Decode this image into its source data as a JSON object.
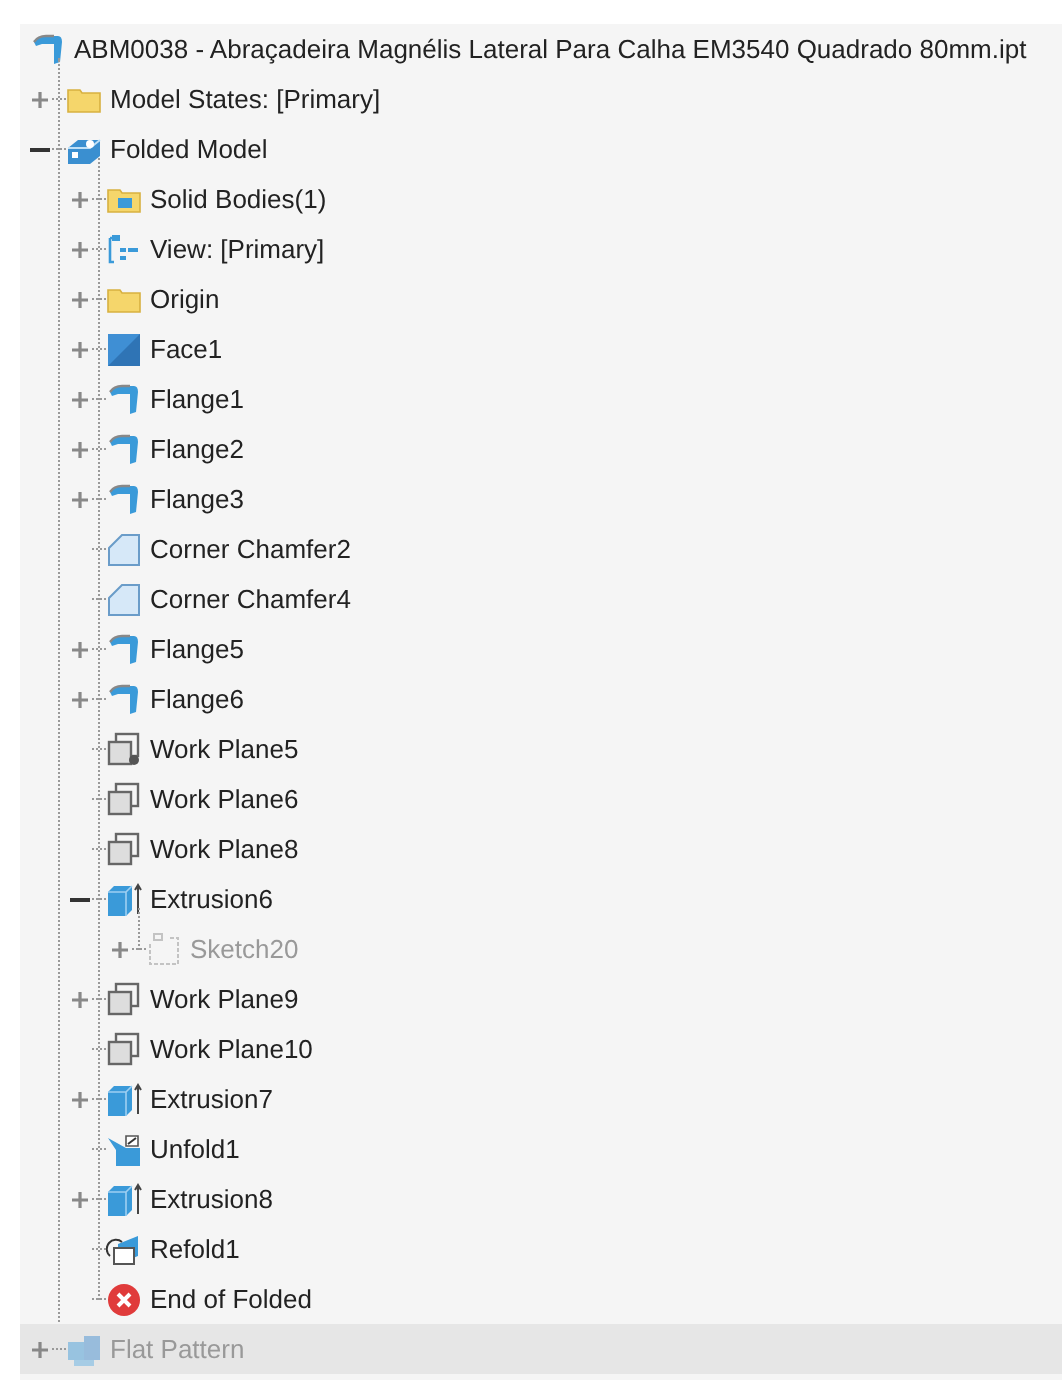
{
  "tree": {
    "label": "ABM0038 - Abraçadeira Magnélis Lateral Para Calha EM3540 Quadrado 80mm.ipt",
    "kind": "sheetmetal",
    "children": [
      {
        "label": "Model States: [Primary]",
        "kind": "folder",
        "expanded": false,
        "disabled": false,
        "selected": false
      },
      {
        "label": "Folded Model",
        "kind": "folded",
        "expanded": true,
        "disabled": false,
        "selected": false,
        "children": [
          {
            "label": "Solid Bodies(1)",
            "kind": "bodies",
            "expanded": false,
            "disabled": false,
            "selected": false
          },
          {
            "label": "View: [Primary]",
            "kind": "view",
            "expanded": false,
            "disabled": false,
            "selected": false
          },
          {
            "label": "Origin",
            "kind": "folder",
            "expanded": false,
            "disabled": false,
            "selected": false
          },
          {
            "label": "Face1",
            "kind": "face",
            "expanded": false,
            "disabled": false,
            "selected": false
          },
          {
            "label": "Flange1",
            "kind": "flange",
            "expanded": false,
            "disabled": false,
            "selected": false
          },
          {
            "label": "Flange2",
            "kind": "flange",
            "expanded": false,
            "disabled": false,
            "selected": false
          },
          {
            "label": "Flange3",
            "kind": "flange",
            "expanded": false,
            "disabled": false,
            "selected": false
          },
          {
            "label": "Corner Chamfer2",
            "kind": "chamfer",
            "disabled": false,
            "selected": false
          },
          {
            "label": "Corner Chamfer4",
            "kind": "chamfer",
            "disabled": false,
            "selected": false
          },
          {
            "label": "Flange5",
            "kind": "flange",
            "expanded": false,
            "disabled": false,
            "selected": false
          },
          {
            "label": "Flange6",
            "kind": "flange",
            "expanded": false,
            "disabled": false,
            "selected": false
          },
          {
            "label": "Work Plane5",
            "kind": "planepoint",
            "disabled": false,
            "selected": false
          },
          {
            "label": "Work Plane6",
            "kind": "plane",
            "disabled": false,
            "selected": false
          },
          {
            "label": "Work Plane8",
            "kind": "plane",
            "disabled": false,
            "selected": false
          },
          {
            "label": "Extrusion6",
            "kind": "extrusion",
            "expanded": true,
            "disabled": false,
            "selected": false,
            "children": [
              {
                "label": "Sketch20",
                "kind": "sketch",
                "expanded": false,
                "disabled": true,
                "selected": false
              }
            ]
          },
          {
            "label": "Work Plane9",
            "kind": "plane",
            "expanded": false,
            "disabled": false,
            "selected": false
          },
          {
            "label": "Work Plane10",
            "kind": "plane",
            "disabled": false,
            "selected": false
          },
          {
            "label": "Extrusion7",
            "kind": "extrusion",
            "expanded": false,
            "disabled": false,
            "selected": false
          },
          {
            "label": "Unfold1",
            "kind": "unfold",
            "disabled": false,
            "selected": false
          },
          {
            "label": "Extrusion8",
            "kind": "extrusion",
            "expanded": false,
            "disabled": false,
            "selected": false
          },
          {
            "label": "Refold1",
            "kind": "refold",
            "disabled": false,
            "selected": false
          },
          {
            "label": "End of Folded",
            "kind": "end",
            "disabled": false,
            "selected": false
          }
        ]
      },
      {
        "label": "Flat Pattern",
        "kind": "flat",
        "expanded": false,
        "disabled": true,
        "selected": true
      }
    ]
  }
}
